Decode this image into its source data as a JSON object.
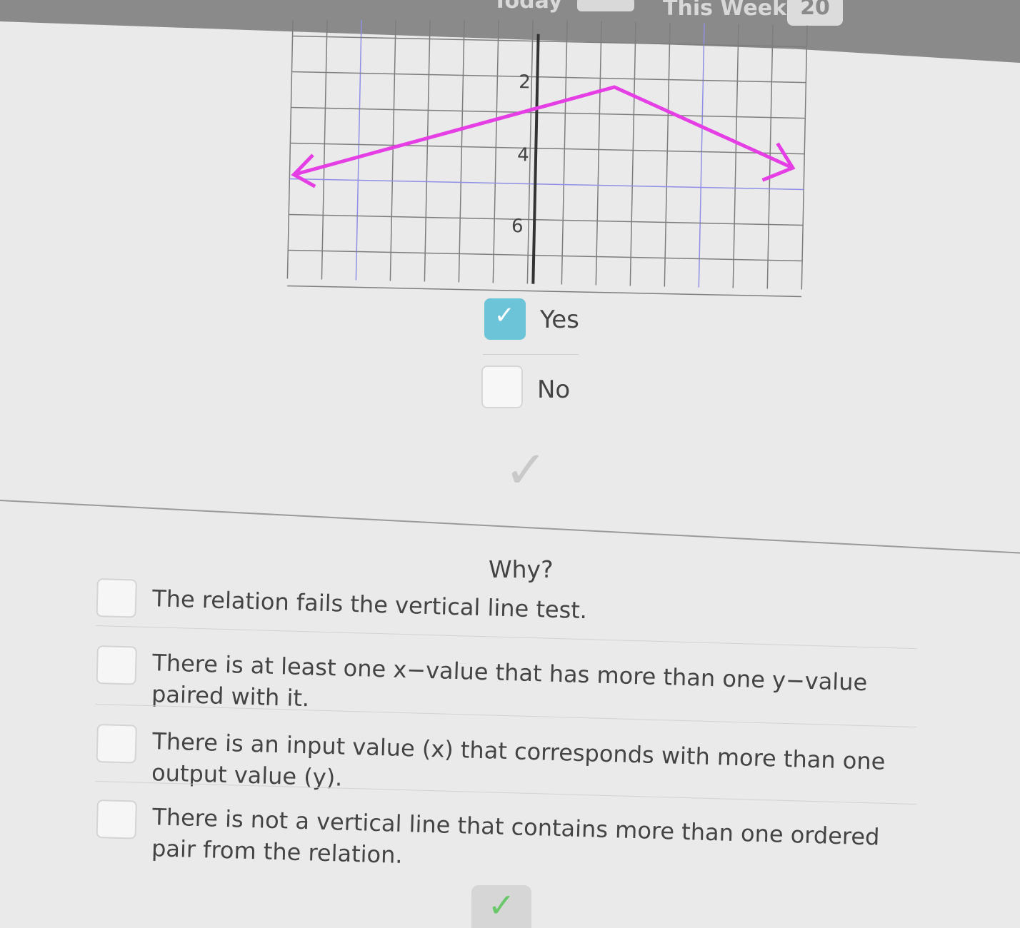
{
  "header": {
    "today_label": "Today",
    "week_label": "This Week",
    "week_count": "20"
  },
  "graph": {
    "y_tick_labels": [
      "2",
      "4",
      "6"
    ],
    "line_color": "#e43ee4",
    "note": ""
  },
  "question_options": {
    "yes": {
      "label": "Yes",
      "checked": true
    },
    "no": {
      "label": "No",
      "checked": false
    }
  },
  "why": {
    "heading": "Why?",
    "reasons": [
      "The relation fails the vertical line test.",
      "There is at least one x−value that has more than one y−value paired with it.",
      "There is an input value (x) that corresponds with more than one output value (y).",
      "There is not a vertical line that contains more than one ordered pair from the relation."
    ]
  },
  "colors": {
    "checked": "#6cc4d8",
    "submit_check": "#6ac86a"
  }
}
